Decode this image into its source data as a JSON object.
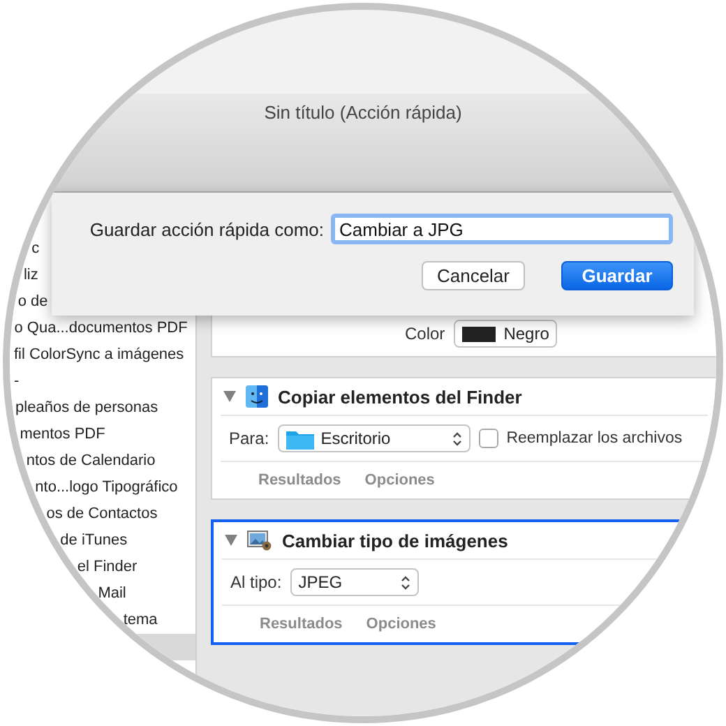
{
  "window": {
    "title": "Sin título (Acción rápida)"
  },
  "sidebar": {
    "items": [
      {
        "label": "c",
        "selected": false
      },
      {
        "label": "liz",
        "selected": false
      },
      {
        "label": "o de",
        "selected": false
      },
      {
        "label": "o Qua...documentos PDF",
        "selected": false
      },
      {
        "label": "fil ColorSync a imágenes",
        "selected": false
      },
      {
        "label": "-",
        "selected": false
      },
      {
        "label": "pleaños de personas",
        "selected": false
      },
      {
        "label": "mentos PDF",
        "selected": false
      },
      {
        "label": "ntos de Calendario",
        "selected": false
      },
      {
        "label": "nto...logo Tipográfico",
        "selected": false
      },
      {
        "label": "os de Contactos",
        "selected": false
      },
      {
        "label": "de iTunes",
        "selected": false
      },
      {
        "label": "el Finder",
        "selected": false
      },
      {
        "label": "Mail",
        "selected": false
      },
      {
        "label": "tema",
        "selected": false
      },
      {
        "selected": true
      }
    ]
  },
  "workflow": {
    "previous_action": {
      "label": "Color",
      "value": "Negro"
    },
    "actions": [
      {
        "kind": "finder",
        "title": "Copiar elementos del Finder",
        "selected": false,
        "field_label": "Para:",
        "popup": "Escritorio",
        "checkbox": {
          "label": "Reemplazar los archivos",
          "checked": false
        },
        "tabs": [
          "Resultados",
          "Opciones"
        ]
      },
      {
        "kind": "image",
        "title": "Cambiar tipo de imágenes",
        "selected": true,
        "field_label": "Al tipo:",
        "popup": "JPEG",
        "tabs": [
          "Resultados",
          "Opciones"
        ]
      }
    ]
  },
  "sheet": {
    "label": "Guardar acción rápida como:",
    "value": "Cambiar a JPG",
    "buttons": [
      {
        "label": "Cancelar",
        "kind": "secondary"
      },
      {
        "label": "Guardar",
        "kind": "primary"
      }
    ]
  }
}
